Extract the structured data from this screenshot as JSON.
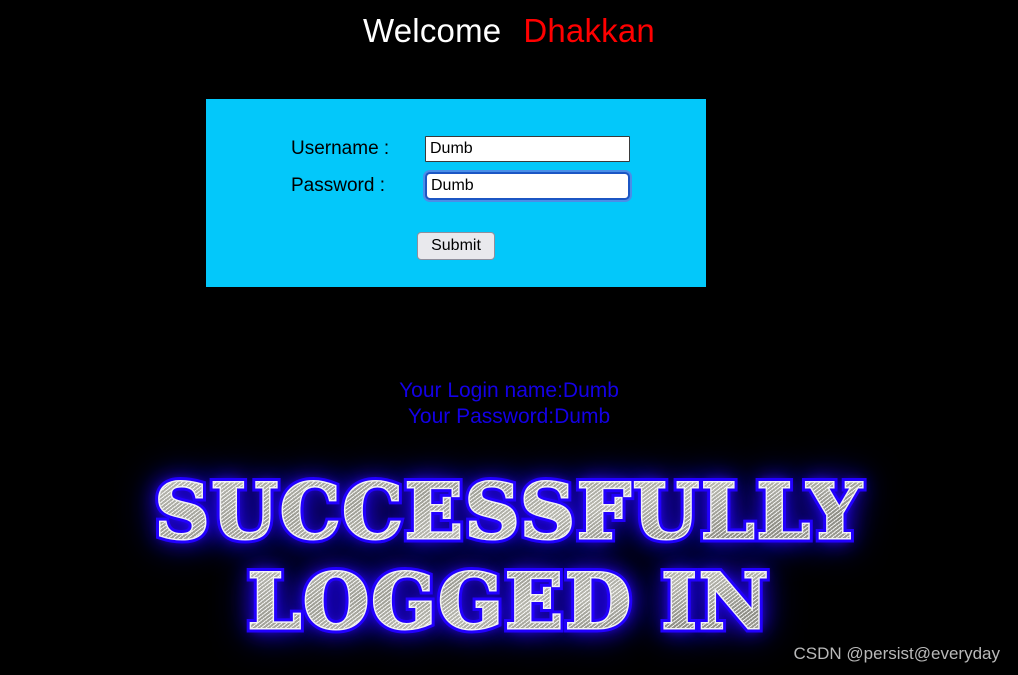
{
  "header": {
    "welcome_label": "Welcome",
    "user_name": "Dhakkan",
    "welcome_color": "#ffffff",
    "name_color": "#ff0000"
  },
  "login_form": {
    "panel_color": "#03c8fa",
    "username": {
      "label": "Username :",
      "value": "Dumb",
      "placeholder": ""
    },
    "password": {
      "label": "Password :",
      "value": "Dumb",
      "placeholder": "",
      "focused": true,
      "focus_ring_color": "#1b56c4"
    },
    "submit_label": "Submit"
  },
  "result": {
    "login_name_line": "Your Login name:Dumb",
    "password_line": "Your Password:Dumb",
    "text_color": "#1400e6"
  },
  "banner": {
    "line1": "SUCCESSFULLY",
    "line2": "LOGGED IN",
    "glow_color": "#2200ff",
    "face_color": "#c0c0b8"
  },
  "watermark": {
    "text": "CSDN @persist@everyday",
    "color": "#b9b9b9"
  }
}
